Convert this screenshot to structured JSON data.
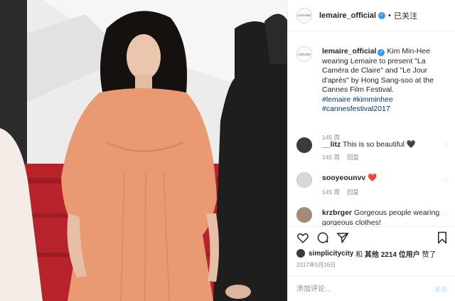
{
  "header": {
    "avatar_text": "LEMAIRE",
    "username": "lemaire_official",
    "verified_mark": "✓",
    "separator": "•",
    "follow_status": "已关注"
  },
  "caption": {
    "username": "lemaire_official",
    "text": " Kim Min-Hee wearing Lemaire to present \"La Caméra de Claire\" and \"Le Jour d'après\" by Hong Sang-soo at the Cannes Film Festival.",
    "hashtags": "#lemaire #kimminhee #cannesfestival2017",
    "time": "145 周"
  },
  "comments": [
    {
      "username": "__litz",
      "text": "This is so beautiful 🖤",
      "time": "145 周",
      "reply": "回复"
    },
    {
      "username": "sooyeounvv",
      "text": "❤️",
      "time": "145 周",
      "reply": "回复"
    },
    {
      "username": "krzbrger",
      "text": "Gorgeous people wearing gorgeous clothes!"
    }
  ],
  "likes": {
    "user": "simplicitycity",
    "connector": "和",
    "others": "其他 2214 位用户",
    "suffix": "赞了"
  },
  "date": "2017年5月26日",
  "add_comment": {
    "placeholder": "添加评论...",
    "post_label": "发布"
  },
  "colors": {
    "link": "#003569",
    "verified": "#3897f0",
    "muted": "#8e8e8e",
    "carpet": "#b3262c",
    "dress": "#e99a73"
  },
  "icons": [
    "heart-icon",
    "comment-icon",
    "share-icon",
    "bookmark-icon"
  ]
}
